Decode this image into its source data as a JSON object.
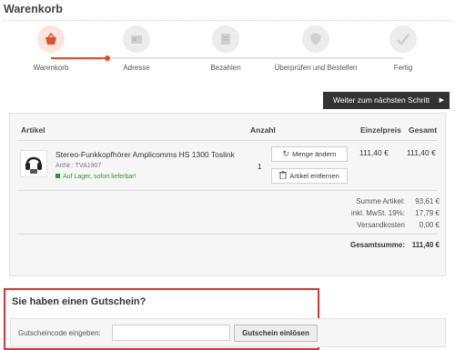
{
  "page": {
    "title": "Warenkorb"
  },
  "steps": [
    {
      "label": "Warenkorb",
      "icon": "basket-icon",
      "active": true
    },
    {
      "label": "Adresse",
      "icon": "address-card-icon",
      "active": false
    },
    {
      "label": "Bezahlen",
      "icon": "payment-icon",
      "active": false
    },
    {
      "label": "Überprüfen und Bestellen",
      "icon": "shield-check-icon",
      "active": false
    },
    {
      "label": "Fertig",
      "icon": "checkmark-icon",
      "active": false
    }
  ],
  "next_button": {
    "label": "Weiter zum nächsten Schritt",
    "arrow": "▶"
  },
  "cart": {
    "headers": {
      "article": "Artikel",
      "quantity": "Anzahl",
      "unit_price": "Einzelpreis",
      "total": "Gesamt"
    },
    "items": [
      {
        "name": "Stereo-Funkkopfhörer Amplicomms HS 1300 Toslink",
        "sku": "ArtNr.: TVA1907",
        "stock": "Auf Lager, sofort lieferbar!",
        "quantity": "1",
        "change_label": "Menge ändern",
        "remove_label": "Artikel entfernen",
        "unit_price": "111,40 €",
        "total_price": "111,40 €"
      }
    ],
    "summary": {
      "subtotal_label": "Summe Artikel:",
      "subtotal_value": "93,61 €",
      "vat_label": "inkl. MwSt. 19%:",
      "vat_value": "17,79 €",
      "shipping_label": "Versandkosten",
      "shipping_value": "0,00 €",
      "grand_label": "Gesamtsumme:",
      "grand_value": "111,40 €"
    }
  },
  "voucher": {
    "title": "Sie haben einen Gutschein?",
    "label": "Gutscheincode eingeben:",
    "input_value": "",
    "input_placeholder": "",
    "button_label": "Gutschein einlösen"
  },
  "colors": {
    "accent": "#e44c2a",
    "highlight_border": "#e03030",
    "stock_green": "#2a9a2a",
    "dark_button": "#333333"
  }
}
